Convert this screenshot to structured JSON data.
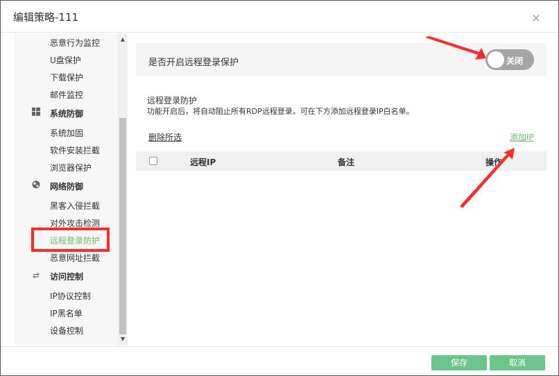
{
  "dialog": {
    "title": "编辑策略-111",
    "close_icon": "close-icon"
  },
  "sidebar": {
    "items_top": [
      {
        "label": "恶意行为监控"
      },
      {
        "label": "U盘保护"
      },
      {
        "label": "下载保护"
      },
      {
        "label": "邮件监控"
      }
    ],
    "groups": [
      {
        "label": "系统防御",
        "icon": "windows-icon",
        "items": [
          {
            "label": "系统加固"
          },
          {
            "label": "软件安装拦截"
          },
          {
            "label": "浏览器保护"
          }
        ]
      },
      {
        "label": "网络防御",
        "icon": "globe-icon",
        "items": [
          {
            "label": "黑客入侵拦截"
          },
          {
            "label": "对外攻击检测"
          },
          {
            "label": "远程登录防护",
            "active": true
          },
          {
            "label": "恶意网址拦截"
          }
        ]
      },
      {
        "label": "访问控制",
        "icon": "transfer-icon",
        "items": [
          {
            "label": "IP协议控制"
          },
          {
            "label": "IP黑名单"
          },
          {
            "label": "设备控制"
          }
        ]
      }
    ]
  },
  "main": {
    "toggle_label": "是否开启远程登录保护",
    "toggle_state": "关闭",
    "desc_title": "远程登录防护",
    "desc_text": "功能开启后，将自动阻止所有RDP远程登录。可在下方添加远程登录IP白名单。",
    "delete_selected": "删除所选",
    "add_ip": "添加IP",
    "table_headers": [
      "远程IP",
      "备注",
      "操作"
    ]
  },
  "footer": {
    "save": "保存",
    "cancel": "取消"
  },
  "colors": {
    "accent_green": "#6cc58a",
    "annotation_red": "#ff2b2b",
    "toggle_off": "#a6a6a6"
  }
}
